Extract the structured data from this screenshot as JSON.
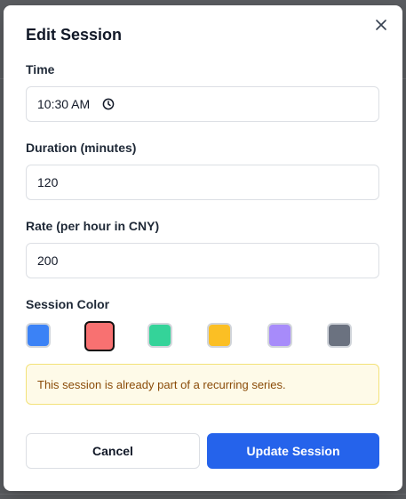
{
  "dialog": {
    "title": "Edit Session"
  },
  "time": {
    "label": "Time",
    "value": "10:30 AM"
  },
  "duration": {
    "label": "Duration (minutes)",
    "value": "120"
  },
  "rate": {
    "label": "Rate (per hour in CNY)",
    "value": "200"
  },
  "session_color": {
    "label": "Session Color",
    "options": [
      {
        "name": "blue",
        "hex": "#3b82f6",
        "selected": false
      },
      {
        "name": "red",
        "hex": "#f87171",
        "selected": true
      },
      {
        "name": "green",
        "hex": "#34d399",
        "selected": false
      },
      {
        "name": "yellow",
        "hex": "#fbbf24",
        "selected": false
      },
      {
        "name": "purple",
        "hex": "#a78bfa",
        "selected": false
      },
      {
        "name": "gray",
        "hex": "#6b7280",
        "selected": false
      }
    ]
  },
  "notice": {
    "text": "This session is already part of a recurring series."
  },
  "actions": {
    "cancel_label": "Cancel",
    "update_label": "Update Session"
  },
  "icons": {
    "close": "close-icon",
    "clock": "clock-icon"
  },
  "colors": {
    "primary": "#2563eb",
    "notice_bg": "#fefae8",
    "notice_text": "#8a4b08"
  }
}
